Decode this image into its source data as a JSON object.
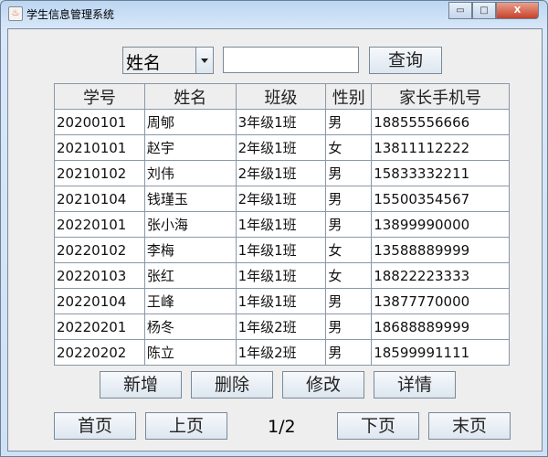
{
  "window": {
    "title": "学生信息管理系统",
    "minimize": "▭",
    "maximize": "□",
    "close": "X"
  },
  "search": {
    "field_selected": "姓名",
    "input_value": "",
    "query_label": "查询"
  },
  "table": {
    "headers": [
      "学号",
      "姓名",
      "班级",
      "性别",
      "家长手机号"
    ],
    "rows": [
      [
        "20200101",
        "周郇",
        "3年级1班",
        "男",
        "18855556666"
      ],
      [
        "20210101",
        "赵宇",
        "2年级1班",
        "女",
        "13811112222"
      ],
      [
        "20210102",
        "刘伟",
        "2年级1班",
        "男",
        "15833332211"
      ],
      [
        "20210104",
        "钱瑾玉",
        "2年级1班",
        "男",
        "15500354567"
      ],
      [
        "20220101",
        "张小海",
        "1年级1班",
        "男",
        "13899990000"
      ],
      [
        "20220102",
        "李梅",
        "1年级1班",
        "女",
        "13588889999"
      ],
      [
        "20220103",
        "张红",
        "1年级1班",
        "女",
        "18822223333"
      ],
      [
        "20220104",
        "王峰",
        "1年级1班",
        "男",
        "13877770000"
      ],
      [
        "20220201",
        "杨冬",
        "1年级2班",
        "男",
        "18688889999"
      ],
      [
        "20220202",
        "陈立",
        "1年级2班",
        "男",
        "18599991111"
      ]
    ]
  },
  "actions": {
    "add": "新增",
    "delete": "删除",
    "edit": "修改",
    "detail": "详情"
  },
  "pagination": {
    "first": "首页",
    "prev": "上页",
    "indicator": "1/2",
    "next": "下页",
    "last": "末页"
  }
}
